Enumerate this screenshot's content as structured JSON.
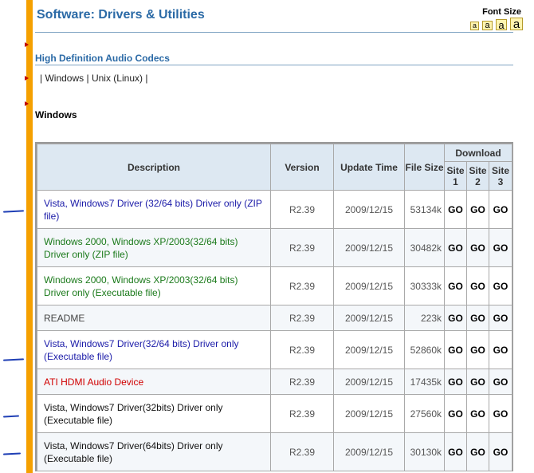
{
  "header": {
    "title": "Software: Drivers & Utilities",
    "font_size": {
      "label": "Font Size",
      "buttons": [
        "a",
        "a",
        "a",
        "a"
      ]
    }
  },
  "section": {
    "heading": "High Definition Audio Codecs",
    "os_links": {
      "sep_start": "|",
      "windows": "Windows",
      "sep_mid": "|",
      "unix": "Unix (Linux)",
      "sep_end": "|"
    }
  },
  "windows_heading": "Windows",
  "table": {
    "headers": {
      "description": "Description",
      "version": "Version",
      "update_time": "Update Time",
      "file_size": "File Size",
      "download": "Download",
      "sites": [
        "Site 1",
        "Site 2",
        "Site 3"
      ]
    },
    "go_label": "GO",
    "rows": [
      {
        "description": "Vista, Windows7 Driver (32/64 bits) Driver only (ZIP file)",
        "version": "R2.39",
        "date": "2009/12/15",
        "size": "53134k"
      },
      {
        "description": "Windows 2000, Windows XP/2003(32/64 bits) Driver only (ZIP file)",
        "version": "R2.39",
        "date": "2009/12/15",
        "size": "30482k"
      },
      {
        "description": "Windows 2000, Windows XP/2003(32/64 bits) Driver only (Executable file)",
        "version": "R2.39",
        "date": "2009/12/15",
        "size": "30333k"
      },
      {
        "description": "README",
        "version": "R2.39",
        "date": "2009/12/15",
        "size": "223k"
      },
      {
        "description": "Vista, Windows7 Driver(32/64 bits) Driver only (Executable file)",
        "version": "R2.39",
        "date": "2009/12/15",
        "size": "52860k"
      },
      {
        "description": "ATI HDMI Audio Device",
        "version": "R2.39",
        "date": "2009/12/15",
        "size": "17435k"
      },
      {
        "description": "Vista, Windows7 Driver(32bits) Driver only (Executable file)",
        "version": "R2.39",
        "date": "2009/12/15",
        "size": "27560k"
      },
      {
        "description": "Vista, Windows7 Driver(64bits) Driver only (Executable file)",
        "version": "R2.39",
        "date": "2009/12/15",
        "size": "30130k"
      }
    ]
  },
  "colors": {
    "accent_bar": "#f5a000",
    "heading_blue": "#2b6aa6",
    "link_blue": "#1a1aa8",
    "link_green": "#1b7a1b",
    "link_red": "#d00000",
    "pen_annotation": "#1f3fb5"
  }
}
